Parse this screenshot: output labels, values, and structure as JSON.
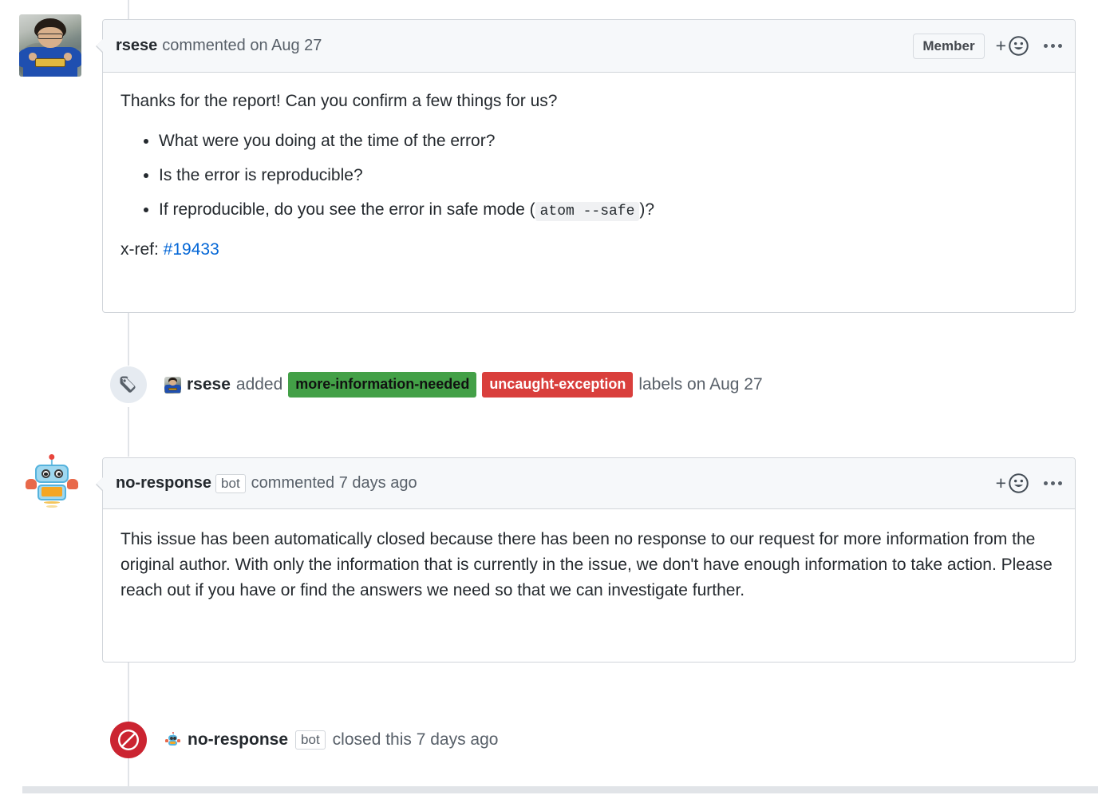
{
  "theme": {
    "link_blue": "#0366d6",
    "header_bg": "#f6f8fa",
    "border": "#d1d5da",
    "closed_red": "#cb2431",
    "label_green_bg": "#43a047",
    "label_green_text": "#111111",
    "label_red_bg": "#d93f3c",
    "label_red_text": "#ffffff"
  },
  "comments": [
    {
      "author": "rsese",
      "meta": "commented on Aug 27",
      "avatar": "user-photo-avatar",
      "association_badge": "Member",
      "actions": {
        "react_label": "+",
        "react_icon": "smiley-icon",
        "menu_icon": "kebab-horizontal-icon"
      },
      "body": {
        "intro": "Thanks for the report! Can you confirm a few things for us?",
        "list": [
          "What were you doing at the time of the error?",
          "Is the error is reproducible?"
        ],
        "list_last_prefix": "If reproducible, do you see the error in safe mode (",
        "list_last_code": "atom --safe",
        "list_last_suffix": ")?",
        "xref_prefix": "x-ref: ",
        "xref_link": "#19433"
      }
    },
    {
      "author": "no-response",
      "bot_badge": "bot",
      "meta": "commented 7 days ago",
      "avatar": "robot-bot-avatar",
      "actions": {
        "react_label": "+",
        "react_icon": "smiley-icon",
        "menu_icon": "kebab-horizontal-icon"
      },
      "body": {
        "text": "This issue has been automatically closed because there has been no response to our request for more information from the original author. With only the information that is currently in the issue, we don't have enough information to take action. Please reach out if you have or find the answers we need so that we can investigate further."
      }
    }
  ],
  "events": [
    {
      "icon": "tag-icon",
      "actor": "rsese",
      "verb": "added",
      "labels": [
        {
          "text": "more-information-needed",
          "bg": "#43a047",
          "fg": "#111111"
        },
        {
          "text": "uncaught-exception",
          "bg": "#d93f3c",
          "fg": "#ffffff"
        }
      ],
      "suffix": "labels on Aug 27"
    },
    {
      "icon": "circle-slash-icon",
      "actor": "no-response",
      "bot_badge": "bot",
      "verb": "closed this 7 days ago"
    }
  ]
}
